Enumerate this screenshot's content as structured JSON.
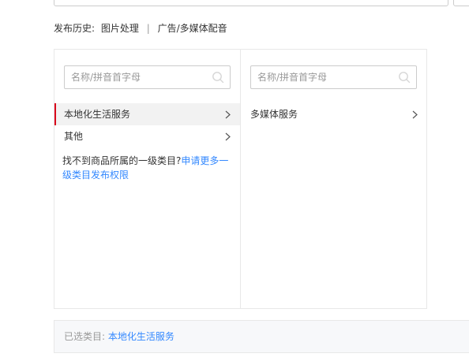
{
  "history": {
    "label": "发布历史:",
    "items": [
      "图片处理",
      "广告/多媒体配音"
    ],
    "separator": "|"
  },
  "left_column": {
    "search_placeholder": "名称/拼音首字母",
    "items": [
      {
        "label": "本地化生活服务",
        "active": true
      },
      {
        "label": "其他",
        "active": false
      }
    ],
    "hint_text": "找不到商品所属的一级类目?",
    "hint_link": "申请更多一级类目发布权限"
  },
  "right_column": {
    "search_placeholder": "名称/拼音首字母",
    "items": [
      {
        "label": "多媒体服务",
        "active": false
      }
    ]
  },
  "footer": {
    "label": "已选类目:",
    "selected": "本地化生活服务"
  },
  "colors": {
    "accent_link": "#3388ff",
    "active_marker": "#d9001b",
    "active_bg": "#f2f2f2"
  },
  "icons": [
    "search-icon",
    "chevron-right-icon"
  ]
}
